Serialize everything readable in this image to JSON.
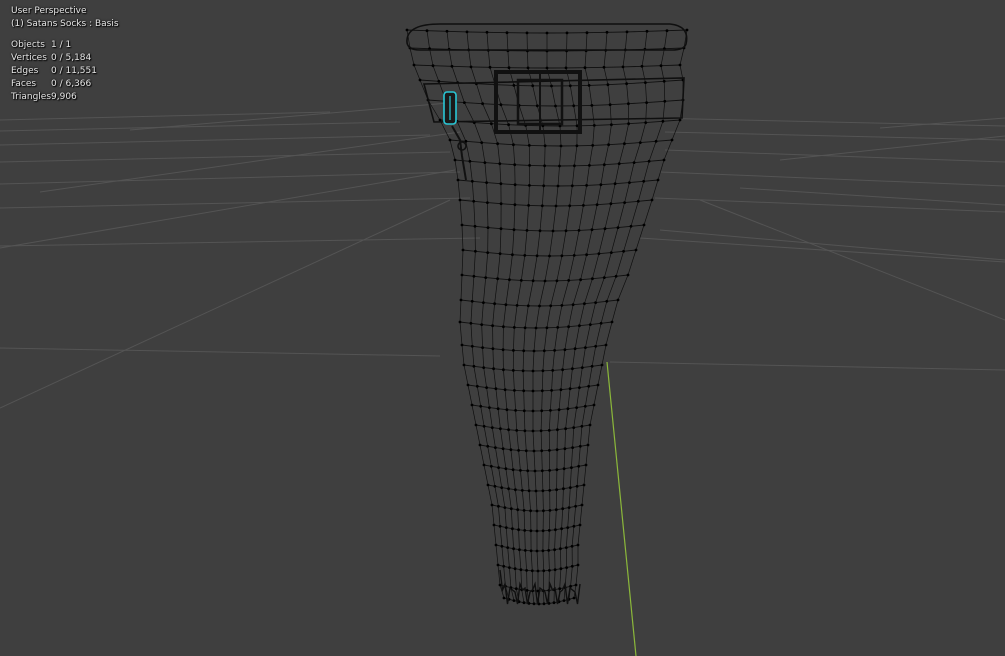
{
  "viewport": {
    "view_name": "User Perspective",
    "object_label": "(1) Satans Socks : Basis",
    "background": "#3f3f3f",
    "grid_color": "#545454",
    "y_axis_color": "#8bb83a",
    "mesh_wire_color": "#0f0f0f",
    "highlight_color": "#29c7d6"
  },
  "stats": [
    {
      "label": "Objects",
      "value": "1 / 1"
    },
    {
      "label": "Vertices",
      "value": "0 / 5,184"
    },
    {
      "label": "Edges",
      "value": "0 / 11,551"
    },
    {
      "label": "Faces",
      "value": "0 / 6,366"
    },
    {
      "label": "Triangles",
      "value": "9,906"
    }
  ]
}
